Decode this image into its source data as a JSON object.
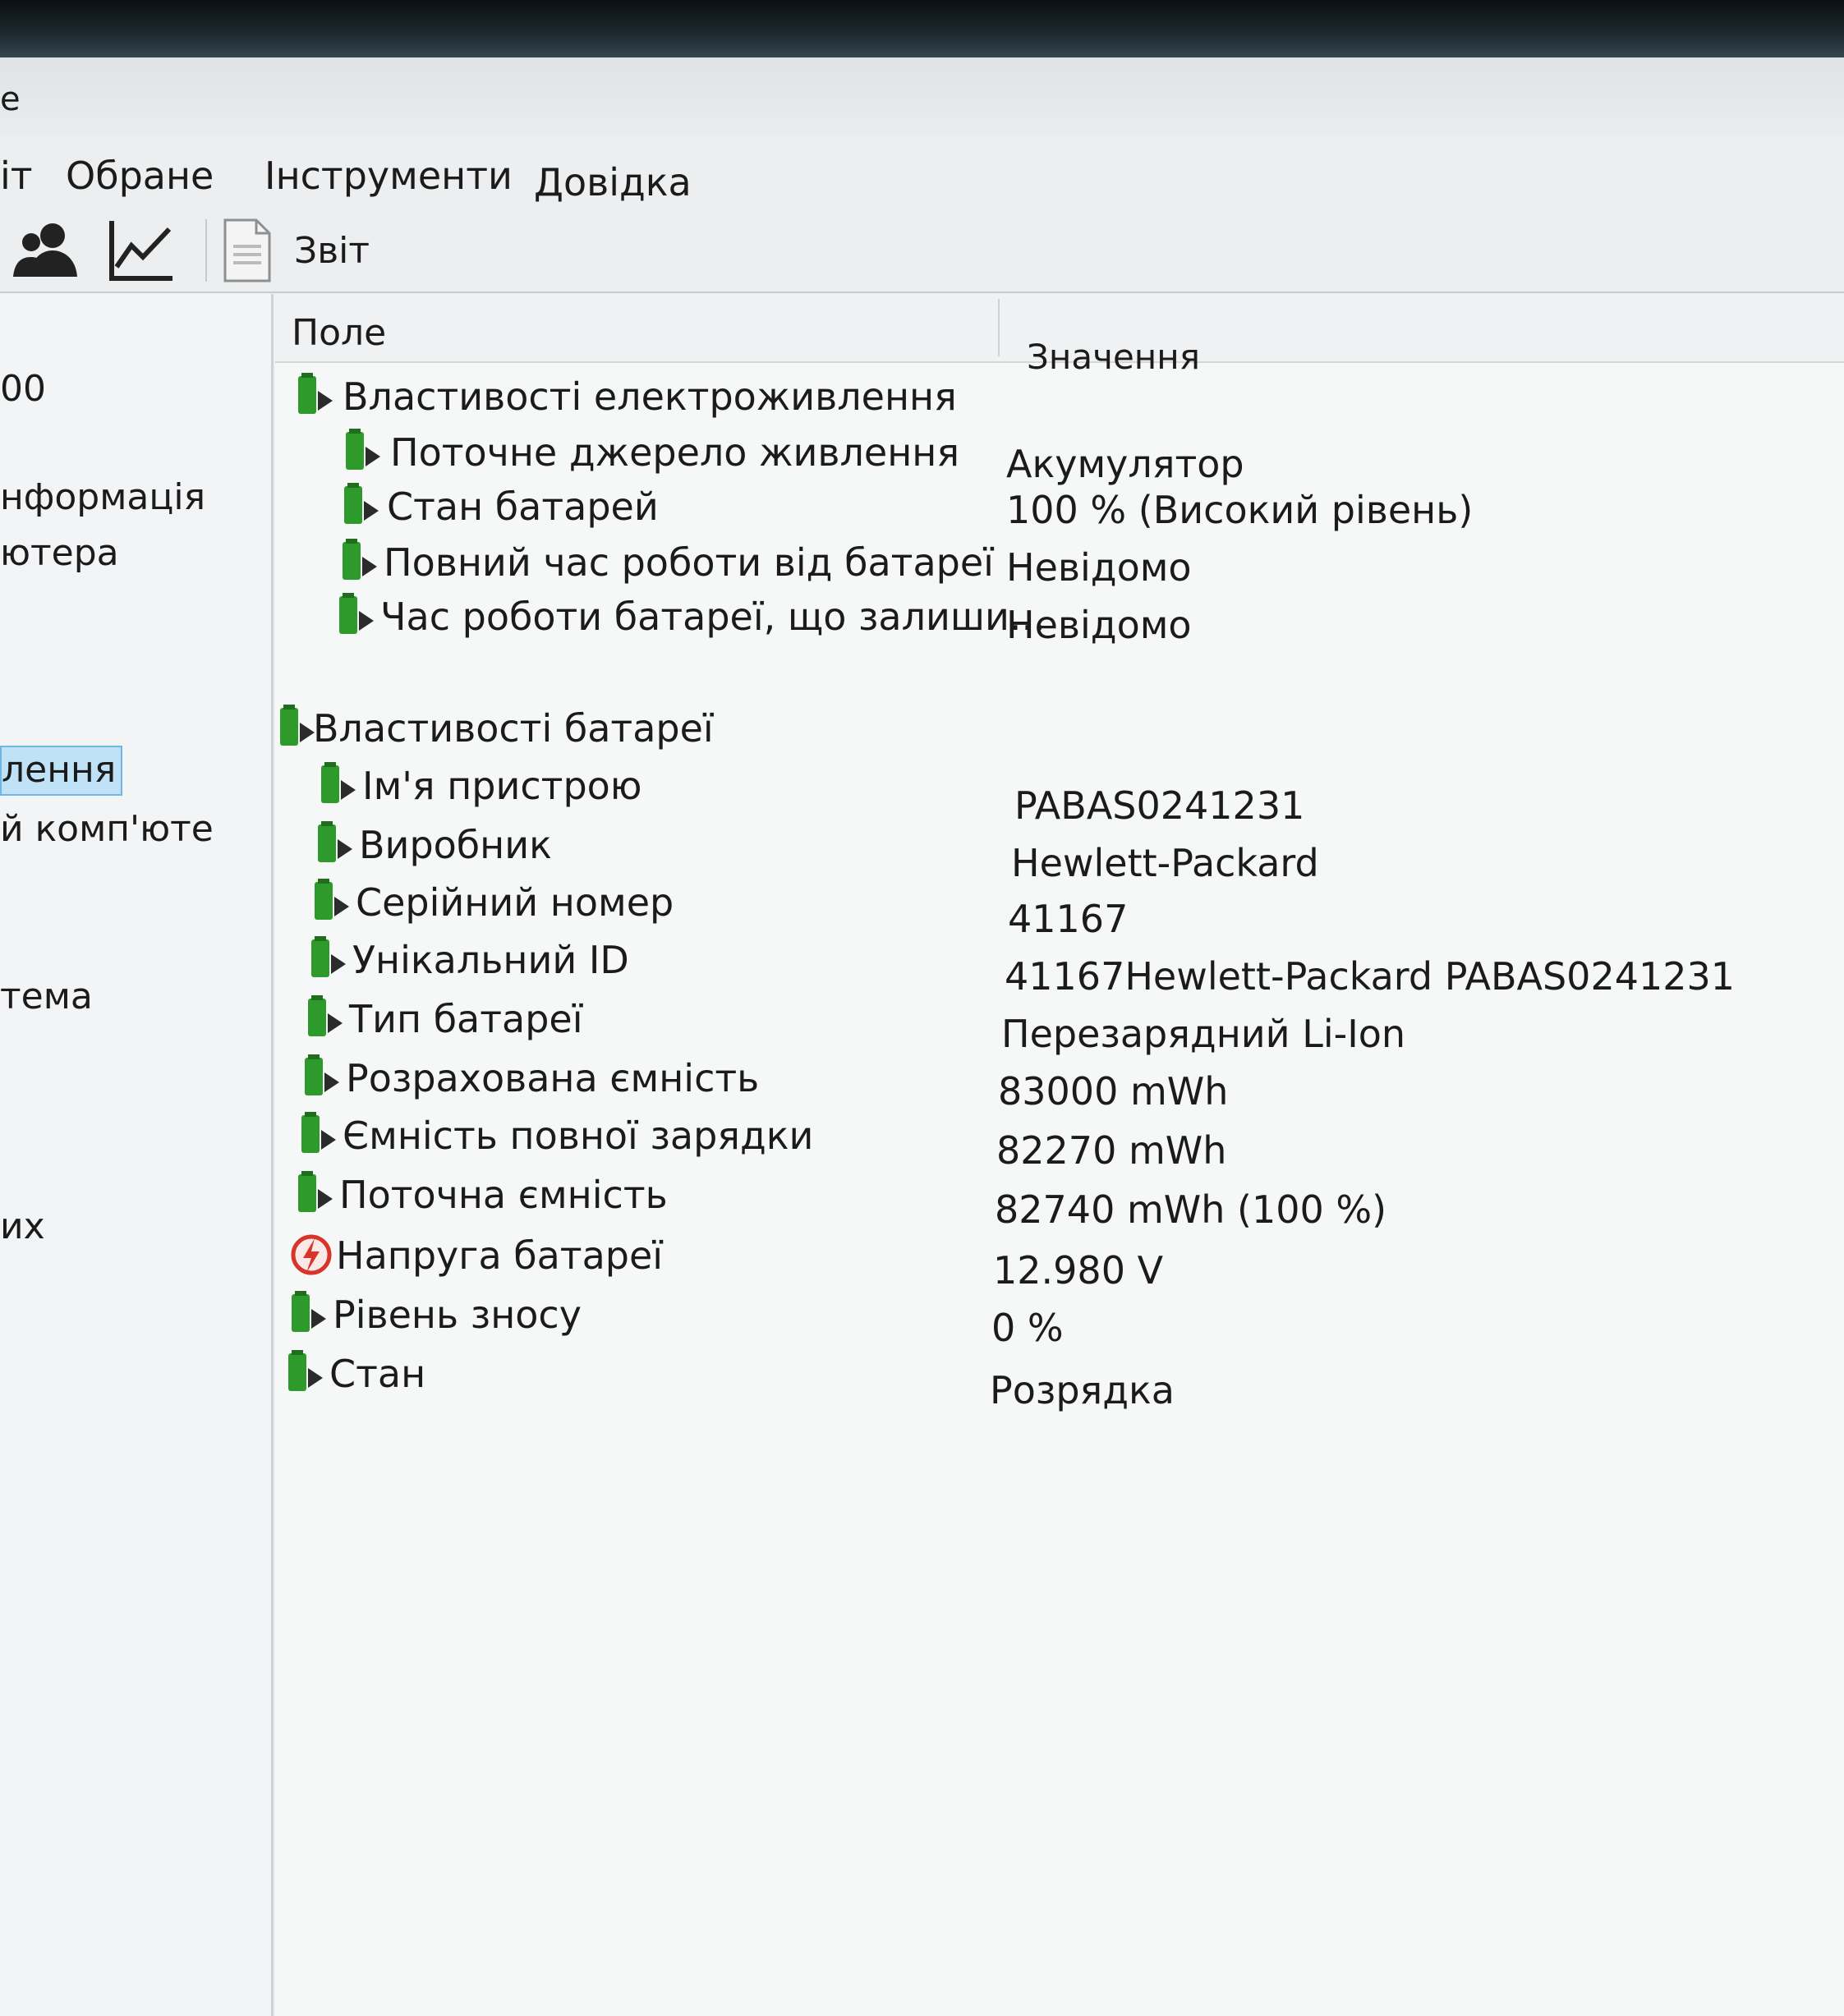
{
  "window": {
    "title_fragment": "e"
  },
  "menu": {
    "items": [
      "іт",
      "Обране",
      "Інструменти",
      "Довідка"
    ]
  },
  "toolbar": {
    "icons": [
      "users-icon",
      "chart-icon"
    ],
    "report_label": "Звіт"
  },
  "sidebar": {
    "items": [
      {
        "label": "00"
      },
      {
        "label": "нформація"
      },
      {
        "label": "ютера"
      },
      {
        "label": "лення",
        "selected": true
      },
      {
        "label": "й комп'юте"
      },
      {
        "label": "тема"
      },
      {
        "label": "их"
      }
    ]
  },
  "table": {
    "columns": {
      "field": "Поле",
      "value": "Значення"
    },
    "groups": [
      {
        "title": "Властивості електроживлення",
        "rows": [
          {
            "field": "Поточне джерело живлення",
            "value": "Акумулятор",
            "icon": "battery-icon"
          },
          {
            "field": "Стан батарей",
            "value": "100 % (Високий рівень)",
            "icon": "battery-icon"
          },
          {
            "field": "Повний час роботи від батареї",
            "value": "Невідомо",
            "icon": "battery-icon"
          },
          {
            "field": "Час роботи батареї, що залиши...",
            "value": "Невідомо",
            "icon": "battery-icon"
          }
        ]
      },
      {
        "title": "Властивості батареї",
        "rows": [
          {
            "field": "Ім'я пристрою",
            "value": "PABAS0241231",
            "icon": "battery-icon"
          },
          {
            "field": "Виробник",
            "value": "Hewlett-Packard",
            "icon": "battery-icon"
          },
          {
            "field": "Серійний номер",
            "value": "41167",
            "icon": "battery-icon"
          },
          {
            "field": "Унікальний ID",
            "value": "41167Hewlett-Packard PABAS0241231",
            "icon": "battery-icon"
          },
          {
            "field": "Тип батареї",
            "value": "Перезарядний Li-Ion",
            "icon": "battery-icon"
          },
          {
            "field": "Розрахована ємність",
            "value": "83000 mWh",
            "icon": "battery-icon"
          },
          {
            "field": "Ємність повної зарядки",
            "value": "82270 mWh",
            "icon": "battery-icon"
          },
          {
            "field": "Поточна ємність",
            "value": "82740 mWh  (100 %)",
            "icon": "battery-icon"
          },
          {
            "field": "Напруга батареї",
            "value": "12.980 V",
            "icon": "voltage-icon"
          },
          {
            "field": "Рівень зносу",
            "value": "0 %",
            "icon": "battery-icon"
          },
          {
            "field": "Стан",
            "value": "Розрядка",
            "icon": "battery-icon"
          }
        ]
      }
    ]
  },
  "colors": {
    "battery_green": "#2f9a2c",
    "voltage_red": "#d8342a",
    "selection": "#bfe2f7"
  }
}
